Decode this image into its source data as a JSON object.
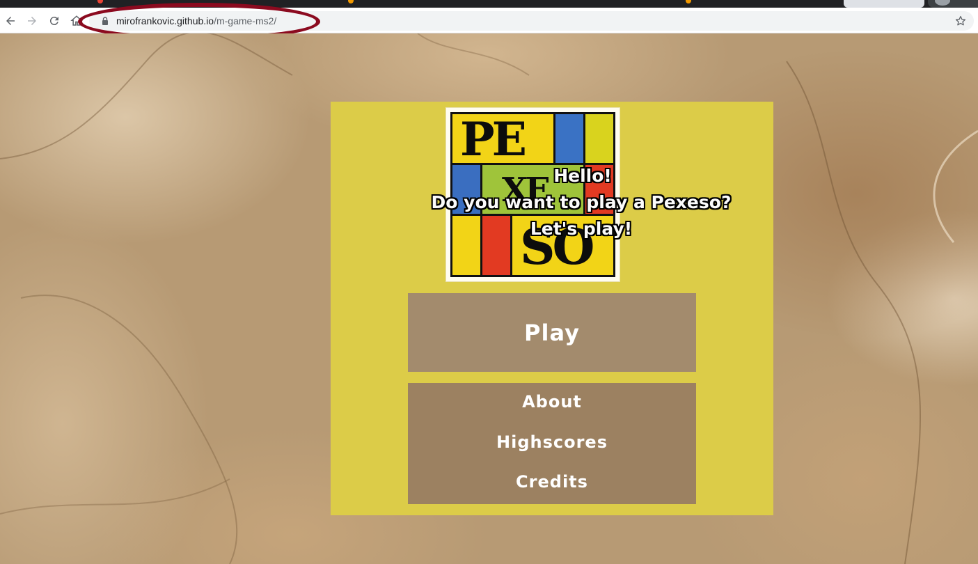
{
  "browser": {
    "address_bar": {
      "host": "mirofrankovic.github.io",
      "path": "/m-game-ms2/"
    },
    "icons": [
      "back-icon",
      "forward-icon",
      "reload-icon",
      "home-icon",
      "lock-icon",
      "star-icon"
    ]
  },
  "annotation": {
    "color": "#8b0a1f",
    "shape": "ellipse"
  },
  "page": {
    "logo": {
      "letters_top": "PE",
      "letters_mid": "XE",
      "letters_bottom": "SO"
    },
    "greeting": {
      "line1": "Hello!",
      "line2": "Do you want to play a Pexeso?",
      "line3": "Let's play!"
    },
    "play_label": "Play",
    "menu": [
      {
        "label": "About"
      },
      {
        "label": "Highscores"
      },
      {
        "label": "Credits"
      }
    ],
    "colors": {
      "card": "#dccc48",
      "play_button": "#a38b6d",
      "menu_box": "#9c8161",
      "background": "#b79a74"
    }
  }
}
